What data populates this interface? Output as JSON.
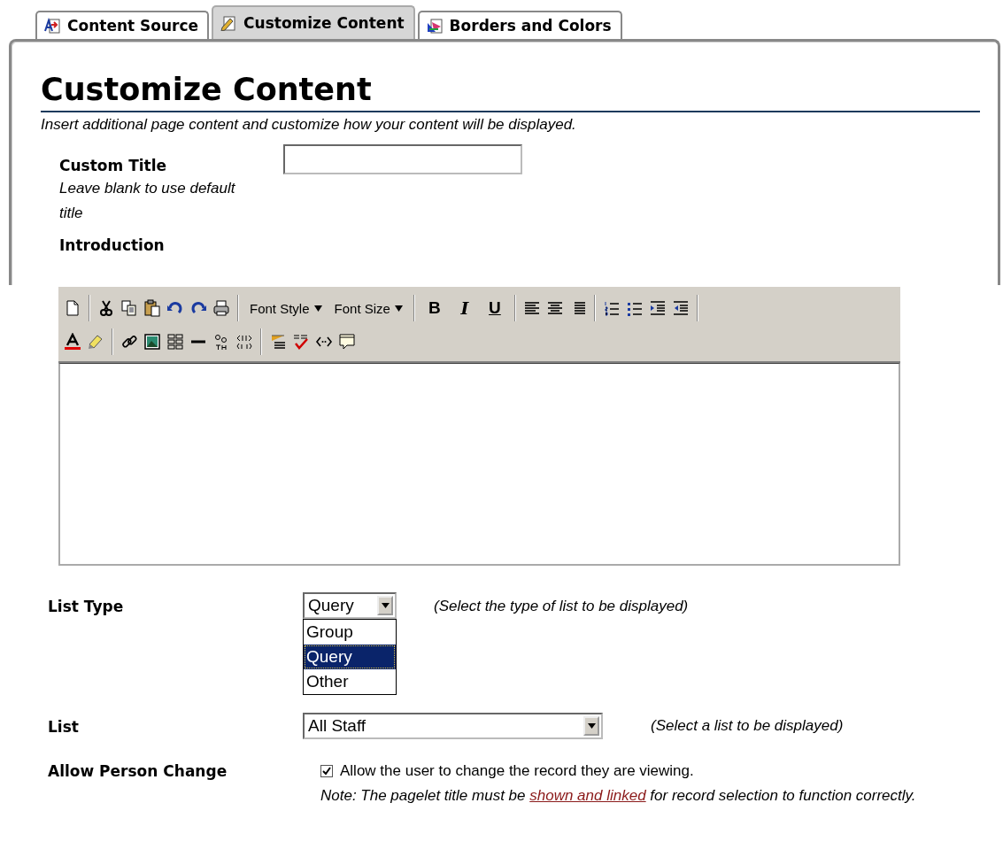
{
  "tabs": [
    {
      "label": "Content Source",
      "selected": false
    },
    {
      "label": "Customize Content",
      "selected": true
    },
    {
      "label": "Borders and Colors",
      "selected": false
    }
  ],
  "heading": "Customize Content",
  "subtitle": "Insert additional page content and customize how your content will be displayed.",
  "custom_title": {
    "label": "Custom Title",
    "hint": "Leave blank to use default title"
  },
  "introduction": {
    "label": "Introduction",
    "toolbar": {
      "font_menus": [
        {
          "label": "Font Style"
        },
        {
          "label": "Font Size"
        }
      ],
      "format_buttons": [
        "B",
        "I",
        "U"
      ]
    }
  },
  "list_type": {
    "label": "List Type",
    "value": "Query",
    "expanded": true,
    "options": [
      {
        "label": "Group",
        "selected": false
      },
      {
        "label": "Query",
        "selected": true
      },
      {
        "label": "Other",
        "selected": false
      }
    ],
    "hint": "(Select the type of list to be displayed)"
  },
  "list": {
    "label": "List",
    "value": "All Staff",
    "hint": "(Select a list to be displayed)"
  },
  "allow_person_change": {
    "label": "Allow Person Change",
    "checked": true,
    "text": "Allow the user to change the record they are viewing.",
    "note": {
      "before": "Note: The pagelet title must be ",
      "link": "shown and linked",
      "after": " for record selection to function correctly."
    }
  }
}
